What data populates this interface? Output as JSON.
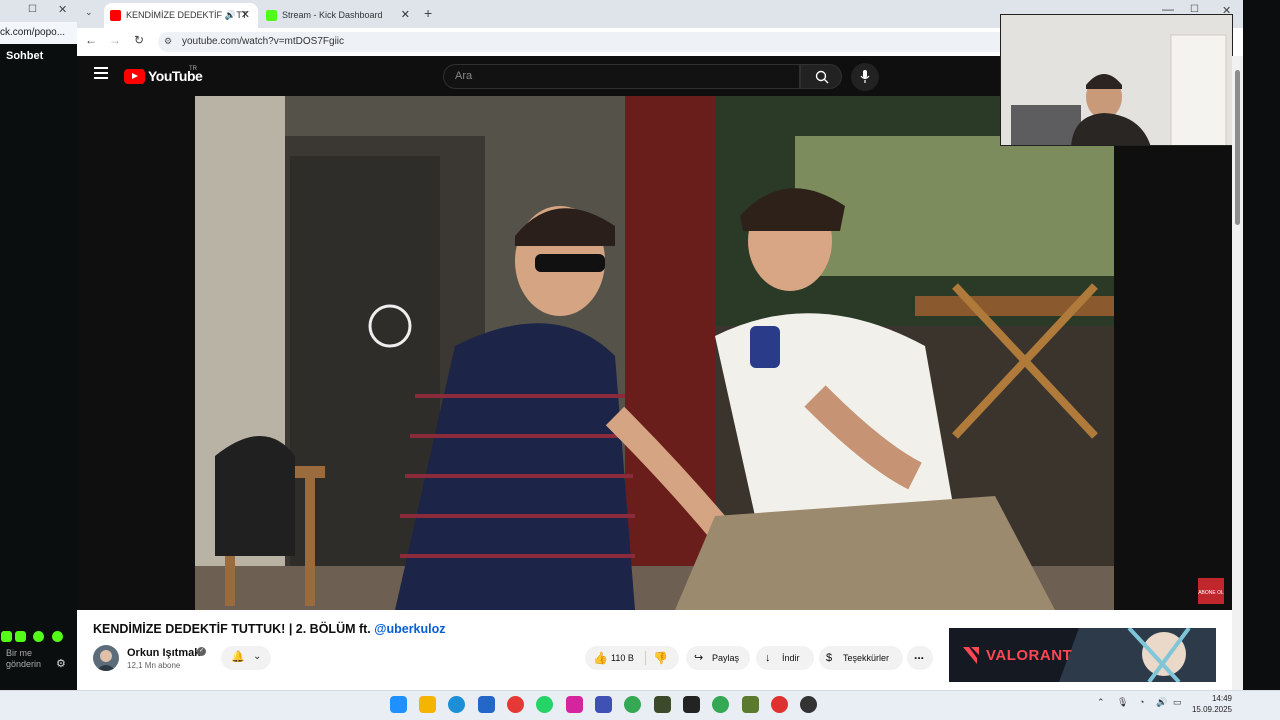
{
  "left_window": {
    "url": "ck.com/popo...",
    "chat_title": "Sohbet",
    "message_placeholder": "Bir me gönderin"
  },
  "browser": {
    "tabs": [
      {
        "label": "KENDİMİZE DEDEKTİF TUTT",
        "active": true
      },
      {
        "label": "Stream - Kick Dashboard",
        "active": false
      }
    ],
    "url": "youtube.com/watch?v=mtDOS7Fgiic"
  },
  "youtube": {
    "logo": "YouTube",
    "region": "TR",
    "search_placeholder": "Ara",
    "video": {
      "title_main": "KENDİMİZE DEDEKTİF TUTTUK! | 2. BÖLÜM ft.",
      "title_mention": "@uberkuloz",
      "watermark": "ABONE OL"
    },
    "channel": {
      "name": "Orkun Işıtmak",
      "subscribers": "12,1 Mn abone"
    },
    "actions": {
      "likes": "110 B",
      "share": "Paylaş",
      "download": "İndir",
      "thanks": "Teşekkürler",
      "more": "..."
    },
    "ad": {
      "brand": "VALORANT"
    }
  },
  "taskbar": {
    "time": "14:49",
    "date": "15.09.2025"
  },
  "colors": {
    "youtube_red": "#ff0000",
    "kick_green": "#53fc18",
    "link_blue": "#065fd4",
    "valorant_red": "#ff4655"
  }
}
